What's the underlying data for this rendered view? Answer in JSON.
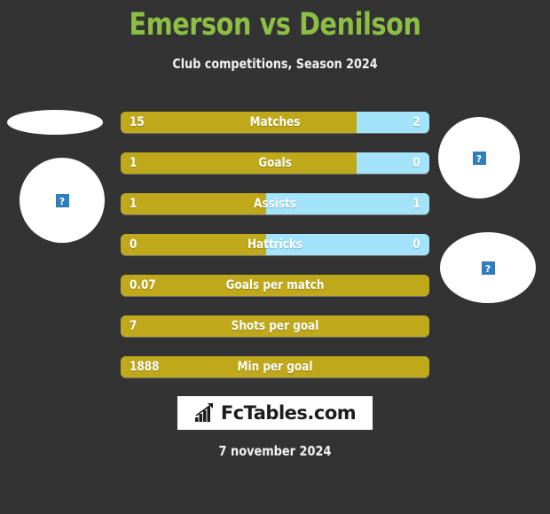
{
  "header": {
    "title": "Emerson vs Denilson",
    "subtitle": "Club competitions, Season 2024",
    "title_color": "#8cbf43",
    "subtitle_color": "#f2f2f2"
  },
  "background_color": "#333333",
  "colors": {
    "home_bar": "#bfa91a",
    "away_bar": "#a3e4fb",
    "text": "#ffffff"
  },
  "players": {
    "home": {
      "name": "Emerson",
      "image_status": "broken",
      "broken_glyph": "?"
    },
    "away": {
      "name": "Denilson",
      "image_status": "broken",
      "broken_glyph": "?"
    }
  },
  "placeholders": [
    {
      "id": "left-top",
      "glyph": ""
    },
    {
      "id": "left-bottom",
      "glyph": "?"
    },
    {
      "id": "right-top",
      "glyph": "?"
    },
    {
      "id": "right-bottom",
      "glyph": "?"
    }
  ],
  "chart_data": {
    "type": "bar",
    "title": "Emerson vs Denilson",
    "subtitle": "Club competitions, Season 2024",
    "orientation": "horizontal-diverging",
    "series": [
      {
        "name": "Emerson",
        "color": "#bfa91a"
      },
      {
        "name": "Denilson",
        "color": "#a3e4fb"
      }
    ],
    "categories": [
      "Matches",
      "Goals",
      "Assists",
      "Hattricks",
      "Goals per match",
      "Shots per goal",
      "Min per goal"
    ],
    "rows": [
      {
        "label": "Matches",
        "left_value": "15",
        "right_value": "2",
        "left_pct": 76.5,
        "has_right": true
      },
      {
        "label": "Goals",
        "left_value": "1",
        "right_value": "0",
        "left_pct": 76.5,
        "has_right": true
      },
      {
        "label": "Assists",
        "left_value": "1",
        "right_value": "1",
        "left_pct": 47,
        "has_right": true
      },
      {
        "label": "Hattricks",
        "left_value": "0",
        "right_value": "0",
        "left_pct": 47,
        "has_right": true
      },
      {
        "label": "Goals per match",
        "left_value": "0.07",
        "right_value": "",
        "left_pct": 100,
        "has_right": false
      },
      {
        "label": "Shots per goal",
        "left_value": "7",
        "right_value": "",
        "left_pct": 100,
        "has_right": false
      },
      {
        "label": "Min per goal",
        "left_value": "1888",
        "right_value": "",
        "left_pct": 100,
        "has_right": false
      }
    ],
    "xlabel": "",
    "ylabel": "",
    "grid": false,
    "legend": "none"
  },
  "footer": {
    "logo_text": "FcTables.com",
    "logo_icon": "bar-chart-arrow-icon",
    "date": "7 november 2024"
  }
}
